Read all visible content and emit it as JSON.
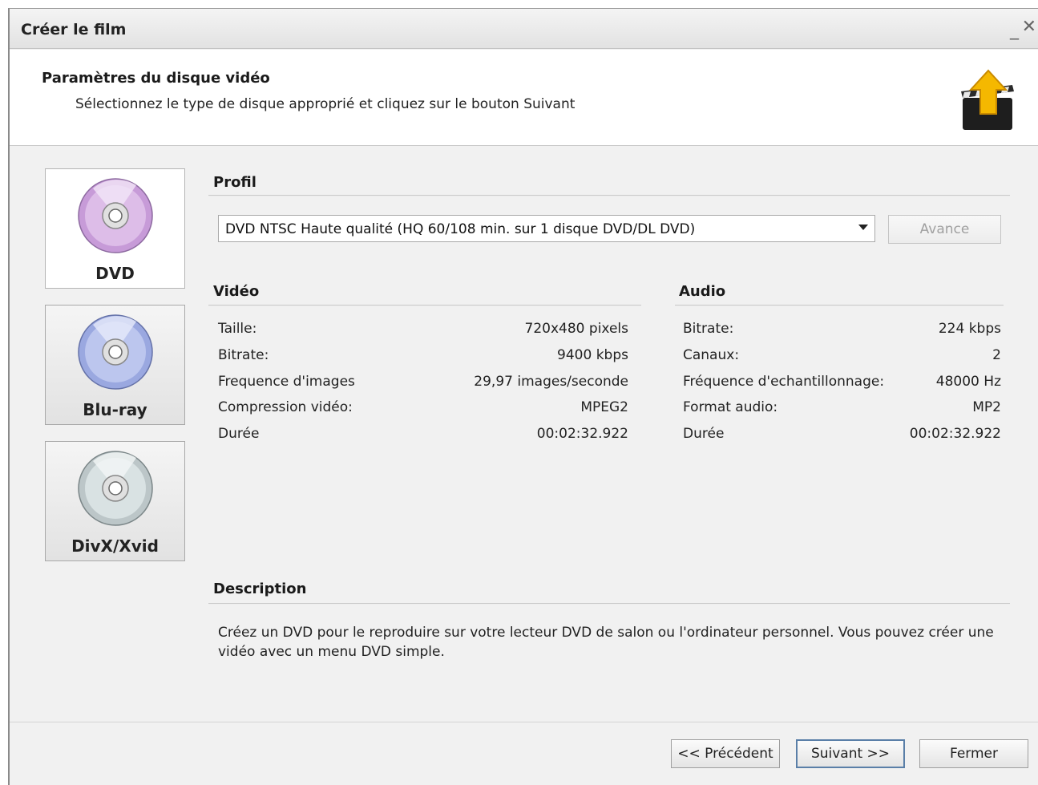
{
  "window": {
    "title": "Créer le film",
    "minimize_glyph": "_",
    "close_glyph": "✕"
  },
  "header": {
    "title": "Paramètres du disque vidéo",
    "subtitle": "Sélectionnez le type de disque approprié et cliquez sur le bouton Suivant",
    "icon": "film-clapper-upload-icon"
  },
  "disc_types": [
    {
      "label": "DVD",
      "icon": "dvd-disc-icon",
      "selected": true,
      "color": "#b78acb"
    },
    {
      "label": "Blu-ray",
      "icon": "bluray-disc-icon",
      "selected": false,
      "color": "#8f9fd8"
    },
    {
      "label": "DivX/Xvid",
      "icon": "divx-disc-icon",
      "selected": false,
      "color": "#b7c2c4"
    }
  ],
  "profile": {
    "section_label": "Profil",
    "selected": "DVD NTSC Haute qualité (HQ 60/108 min. sur 1 disque DVD/DL DVD)",
    "advanced_button": "Avance"
  },
  "video": {
    "section_label": "Vidéo",
    "rows": [
      {
        "label": "Taille:",
        "value": "720x480 pixels"
      },
      {
        "label": "Bitrate:",
        "value": "9400 kbps"
      },
      {
        "label": "Frequence d'images",
        "value": "29,97 images/seconde"
      },
      {
        "label": "Compression vidéo:",
        "value": "MPEG2"
      },
      {
        "label": "Durée",
        "value": "00:02:32.922"
      }
    ]
  },
  "audio": {
    "section_label": "Audio",
    "rows": [
      {
        "label": "Bitrate:",
        "value": "224 kbps"
      },
      {
        "label": "Canaux:",
        "value": "2"
      },
      {
        "label": "Fréquence d'echantillonnage:",
        "value": "48000 Hz"
      },
      {
        "label": "Format audio:",
        "value": "MP2"
      },
      {
        "label": "Durée",
        "value": "00:02:32.922"
      }
    ]
  },
  "description": {
    "section_label": "Description",
    "text": "Créez un DVD pour le reproduire sur votre lecteur DVD de salon ou l'ordinateur personnel. Vous pouvez créer une vidéo avec un menu DVD simple."
  },
  "footer": {
    "back_button": "<< Précédent",
    "next_button": "Suivant >>",
    "close_button": "Fermer"
  }
}
